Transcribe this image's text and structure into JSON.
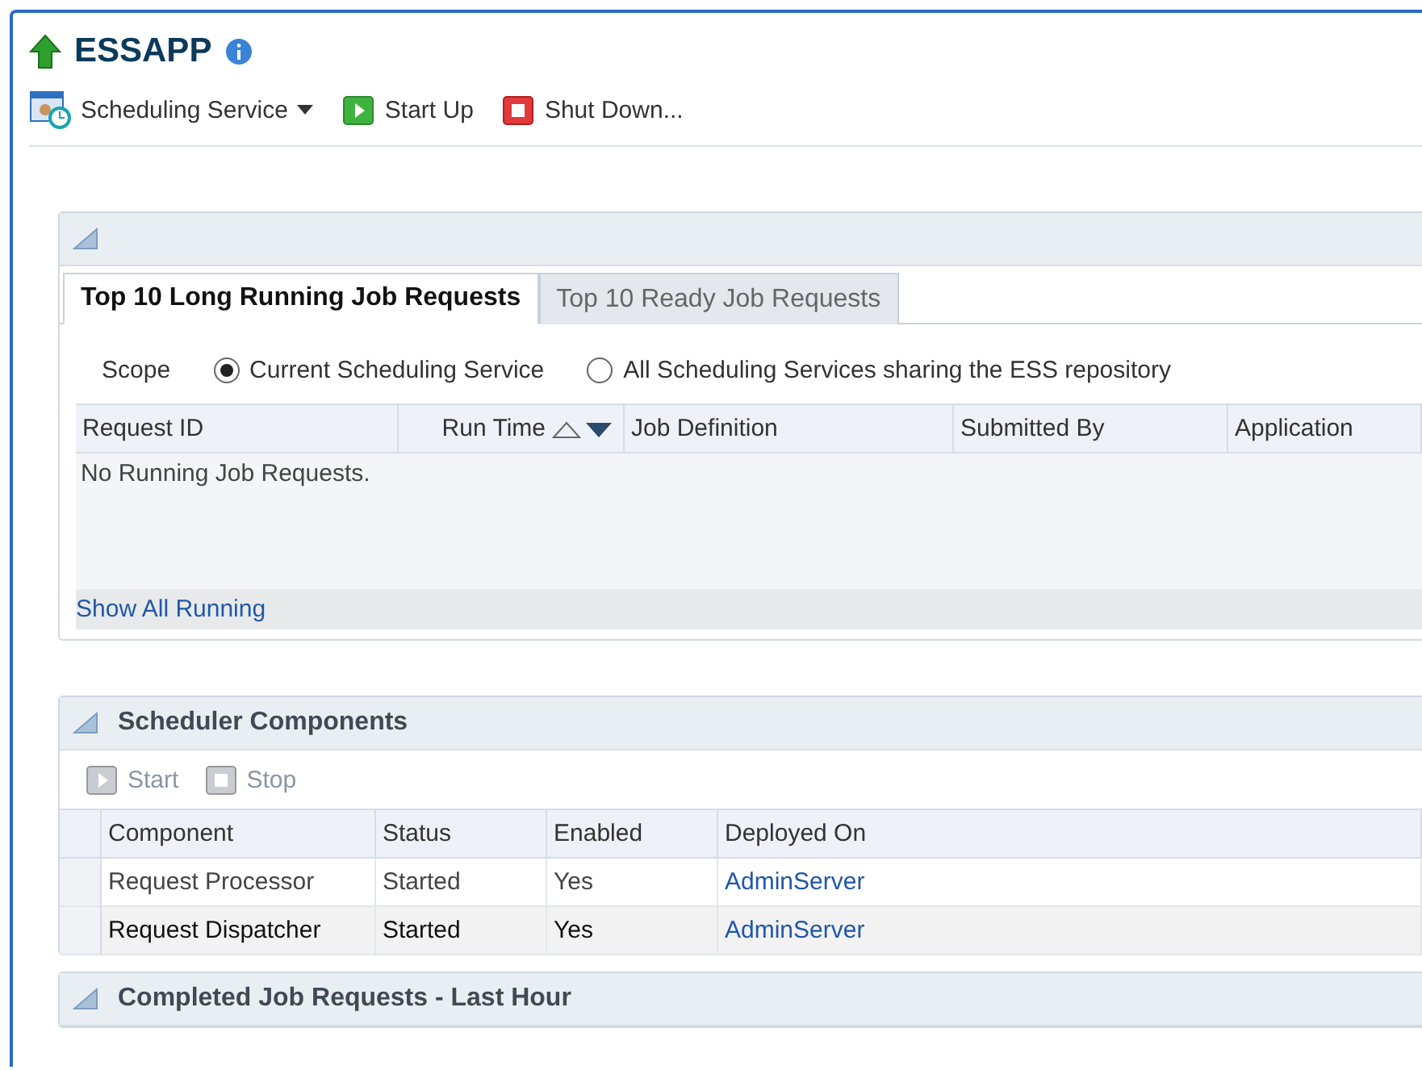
{
  "header": {
    "title": "ESSAPP"
  },
  "toolbar": {
    "menu": "Scheduling Service",
    "actions": [
      {
        "kind": "start",
        "label": "Start Up"
      },
      {
        "kind": "stop",
        "label": "Shut Down..."
      }
    ]
  },
  "running_panel": {
    "tabs": [
      {
        "label": "Top 10 Long Running Job Requests",
        "selected": true
      },
      {
        "label": "Top 10 Ready Job Requests",
        "selected": false
      }
    ],
    "scope": {
      "label": "Scope",
      "options": [
        {
          "label": "Current Scheduling Service",
          "selected": true
        },
        {
          "label": "All Scheduling Services sharing the ESS repository",
          "selected": false
        }
      ]
    },
    "table": {
      "columns": [
        {
          "label": "Request ID",
          "sorted": false
        },
        {
          "label": "Run Time",
          "sorted": true
        },
        {
          "label": "Job Definition",
          "sorted": false
        },
        {
          "label": "Submitted By",
          "sorted": false
        },
        {
          "label": "Application",
          "sorted": false
        }
      ],
      "empty_text": "No Running Job Requests."
    },
    "footer_link": "Show All Running"
  },
  "components_panel": {
    "title": "Scheduler Components",
    "actions": [
      {
        "kind": "start",
        "label": "Start",
        "disabled": true
      },
      {
        "kind": "stop",
        "label": "Stop",
        "disabled": true
      }
    ],
    "columns": [
      "Component",
      "Status",
      "Enabled",
      "Deployed On"
    ],
    "rows": [
      {
        "component": "Request Processor",
        "status": "Started",
        "enabled": "Yes",
        "deployed_on": "AdminServer",
        "selected": false
      },
      {
        "component": "Request Dispatcher",
        "status": "Started",
        "enabled": "Yes",
        "deployed_on": "AdminServer",
        "selected": true
      }
    ]
  },
  "completed_panel": {
    "title": "Completed Job Requests - Last Hour"
  }
}
